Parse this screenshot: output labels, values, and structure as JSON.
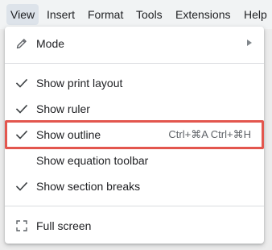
{
  "menubar": {
    "items": [
      {
        "label": "View"
      },
      {
        "label": "Insert"
      },
      {
        "label": "Format"
      },
      {
        "label": "Tools"
      },
      {
        "label": "Extensions"
      },
      {
        "label": "Help"
      }
    ]
  },
  "menu": {
    "mode": {
      "label": "Mode",
      "icon": "pencil-icon"
    },
    "print_layout": {
      "label": "Show print layout",
      "checked": true
    },
    "ruler": {
      "label": "Show ruler",
      "checked": true
    },
    "outline": {
      "label": "Show outline",
      "checked": true,
      "shortcut": "Ctrl+⌘A Ctrl+⌘H"
    },
    "equation_toolbar": {
      "label": "Show equation toolbar",
      "checked": false
    },
    "section_breaks": {
      "label": "Show section breaks",
      "checked": true
    },
    "full_screen": {
      "label": "Full screen",
      "icon": "fullscreen-icon"
    }
  },
  "colors": {
    "highlight": "#e3564e",
    "menubar_active": "#dde3ea",
    "text": "#202124",
    "shortcut": "#5f6368"
  }
}
